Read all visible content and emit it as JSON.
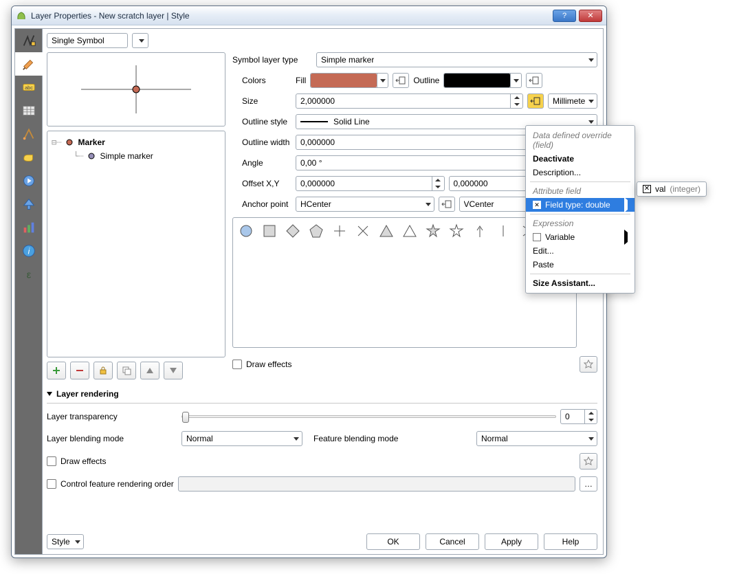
{
  "window": {
    "title": "Layer Properties - New scratch layer | Style"
  },
  "symbol_type_combo": "Single Symbol",
  "tree": {
    "root": "Marker",
    "child": "Simple marker"
  },
  "form": {
    "symbol_layer_type_label": "Symbol layer type",
    "symbol_layer_type_value": "Simple marker",
    "colors_label": "Colors",
    "fill_label": "Fill",
    "fill_color": "#c46a55",
    "outline_label": "Outline",
    "outline_color": "#000000",
    "size_label": "Size",
    "size_value": "2,000000",
    "size_unit": "Millimeter",
    "outline_style_label": "Outline style",
    "outline_style_value": "Solid Line",
    "outline_width_label": "Outline width",
    "outline_width_value": "0,000000",
    "angle_label": "Angle",
    "angle_value": "0,00 °",
    "offset_label": "Offset X,Y",
    "offset_x": "0,000000",
    "offset_y": "0,000000",
    "anchor_label": "Anchor point",
    "anchor_h": "HCenter",
    "anchor_v": "VCenter"
  },
  "draw_effects_label": "Draw effects",
  "section": {
    "header": "Layer rendering",
    "transparency_label": "Layer transparency",
    "transparency_value": "0",
    "layer_blend_label": "Layer blending mode",
    "layer_blend_value": "Normal",
    "feature_blend_label": "Feature blending mode",
    "feature_blend_value": "Normal",
    "draw_effects2": "Draw effects",
    "control_order": "Control feature rendering order"
  },
  "footer": {
    "style": "Style",
    "ok": "OK",
    "cancel": "Cancel",
    "apply": "Apply",
    "help": "Help"
  },
  "ctx": {
    "header": "Data defined override (field)",
    "deactivate": "Deactivate",
    "description": "Description...",
    "attr_field": "Attribute field",
    "field_type": "Field type: double",
    "expression": "Expression",
    "variable": "Variable",
    "edit": "Edit...",
    "paste": "Paste",
    "size_assistant": "Size Assistant..."
  },
  "submenu": {
    "name": "val",
    "type": "(integer)"
  }
}
